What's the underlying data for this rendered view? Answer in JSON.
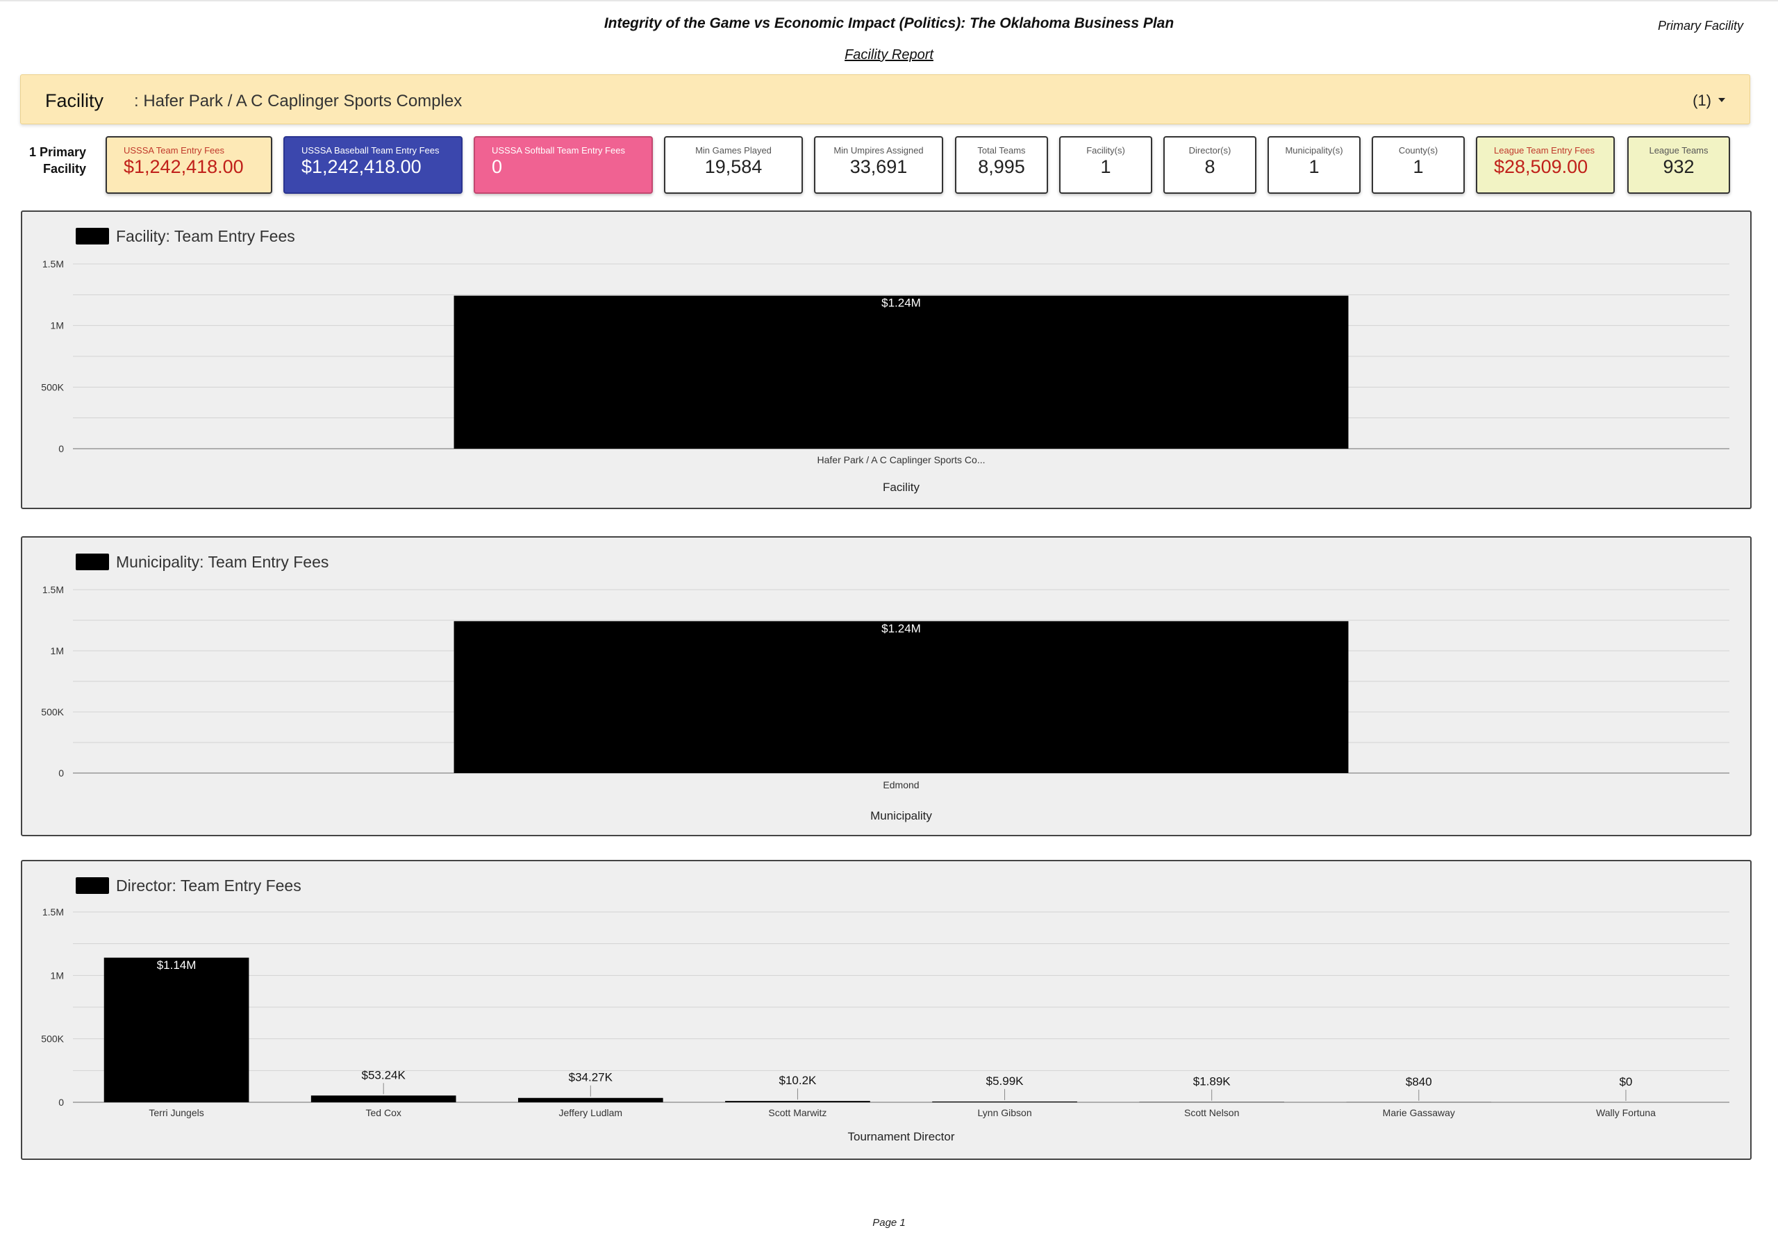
{
  "header": {
    "title": "Integrity of the Game vs Economic Impact (Politics): The Oklahoma Business Plan",
    "subtitle": "Facility Report",
    "tag": "Primary Facility"
  },
  "facility_bar": {
    "label": "Facility",
    "value": ": Hafer Park / A C Caplinger Sports Complex",
    "count": "(1)"
  },
  "primary_label": "1 Primary Facility",
  "tiles": [
    {
      "label": "USSSA Team Entry Fees",
      "value": "$1,242,418.00",
      "bg": "#fde9b6",
      "label_color": "#c0392b",
      "value_color": "#c0201a"
    },
    {
      "label": "USSSA Baseball Team Entry Fees",
      "value": "$1,242,418.00",
      "bg": "#3b47ad",
      "label_color": "#ffffff",
      "value_color": "#ffffff"
    },
    {
      "label": "USSSA Softball Team Entry Fees",
      "value": "0",
      "bg": "#f06292",
      "label_color": "#ffffff",
      "value_color": "#ffffff"
    },
    {
      "label": "Min Games Played",
      "value": "19,584",
      "bg": "#ffffff",
      "label_color": "#555555",
      "value_color": "#222222"
    },
    {
      "label": "Min Umpires Assigned",
      "value": "33,691",
      "bg": "#ffffff",
      "label_color": "#555555",
      "value_color": "#222222"
    },
    {
      "label": "Total Teams",
      "value": "8,995",
      "bg": "#ffffff",
      "label_color": "#555555",
      "value_color": "#222222"
    },
    {
      "label": "Facility(s)",
      "value": "1",
      "bg": "#ffffff",
      "label_color": "#555555",
      "value_color": "#222222"
    },
    {
      "label": "Director(s)",
      "value": "8",
      "bg": "#ffffff",
      "label_color": "#555555",
      "value_color": "#222222"
    },
    {
      "label": "Municipality(s)",
      "value": "1",
      "bg": "#ffffff",
      "label_color": "#555555",
      "value_color": "#222222"
    },
    {
      "label": "County(s)",
      "value": "1",
      "bg": "#ffffff",
      "label_color": "#555555",
      "value_color": "#222222"
    },
    {
      "label": "League Team Entry Fees",
      "value": "$28,509.00",
      "bg": "#f2f3c4",
      "label_color": "#c0392b",
      "value_color": "#c0201a"
    },
    {
      "label": "League Teams",
      "value": "932",
      "bg": "#f2f3c4",
      "label_color": "#555555",
      "value_color": "#222222"
    }
  ],
  "chart_data": [
    {
      "type": "bar",
      "title": "Facility: Team Entry Fees",
      "xlabel": "Facility",
      "categories": [
        "Hafer Park / A C Caplinger Sports Co..."
      ],
      "values": [
        1242418
      ],
      "data_labels": [
        "$1.24M"
      ],
      "yticks": [
        "0",
        "500K",
        "1M",
        "1.5M"
      ],
      "ylim": [
        0,
        1500000
      ],
      "grid": true,
      "legend": "top-left",
      "color": "#000000"
    },
    {
      "type": "bar",
      "title": "Municipality: Team Entry Fees",
      "xlabel": "Municipality",
      "categories": [
        "Edmond"
      ],
      "values": [
        1242418
      ],
      "data_labels": [
        "$1.24M"
      ],
      "yticks": [
        "0",
        "500K",
        "1M",
        "1.5M"
      ],
      "ylim": [
        0,
        1500000
      ],
      "grid": true,
      "legend": "top-left",
      "color": "#000000"
    },
    {
      "type": "bar",
      "title": "Director: Team Entry Fees",
      "xlabel": "Tournament Director",
      "categories": [
        "Terri Jungels",
        "Ted Cox",
        "Jeffery Ludlam",
        "Scott Marwitz",
        "Lynn Gibson",
        "Scott Nelson",
        "Marie Gassaway",
        "Wally Fortuna"
      ],
      "values": [
        1140000,
        53240,
        34270,
        10200,
        5990,
        1890,
        840,
        0
      ],
      "data_labels": [
        "$1.14M",
        "$53.24K",
        "$34.27K",
        "$10.2K",
        "$5.99K",
        "$1.89K",
        "$840",
        "$0"
      ],
      "yticks": [
        "0",
        "500K",
        "1M",
        "1.5M"
      ],
      "ylim": [
        0,
        1500000
      ],
      "grid": true,
      "legend": "top-left",
      "color": "#000000"
    }
  ],
  "footer": {
    "page": "Page 1"
  }
}
